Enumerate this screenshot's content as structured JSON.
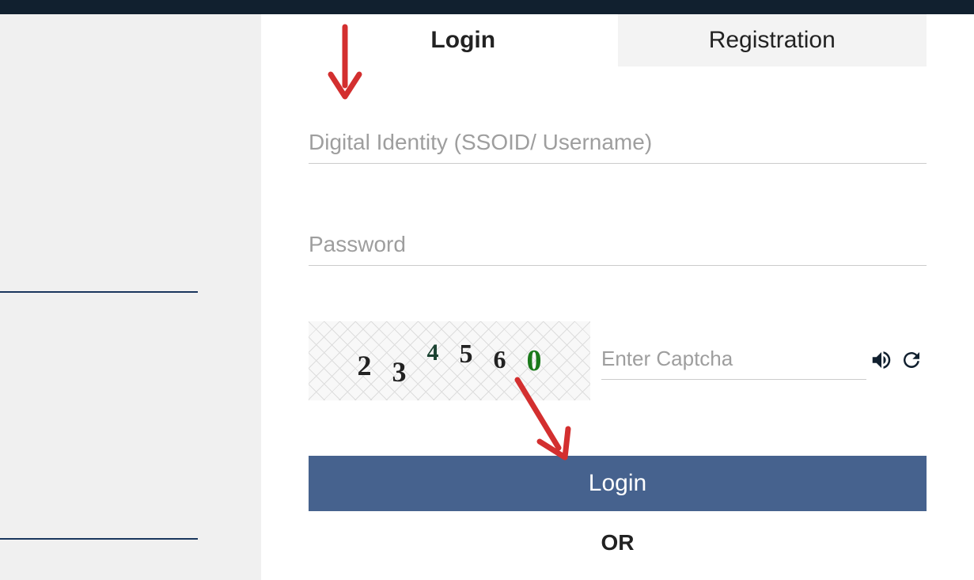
{
  "tabs": {
    "login": "Login",
    "registration": "Registration"
  },
  "fields": {
    "identity_placeholder": "Digital Identity (SSOID/ Username)",
    "password_placeholder": "Password",
    "captcha_placeholder": "Enter Captcha"
  },
  "captcha": {
    "digits": [
      "2",
      "3",
      "4",
      "5",
      "6",
      "0"
    ]
  },
  "buttons": {
    "login": "Login"
  },
  "labels": {
    "or": "OR"
  }
}
